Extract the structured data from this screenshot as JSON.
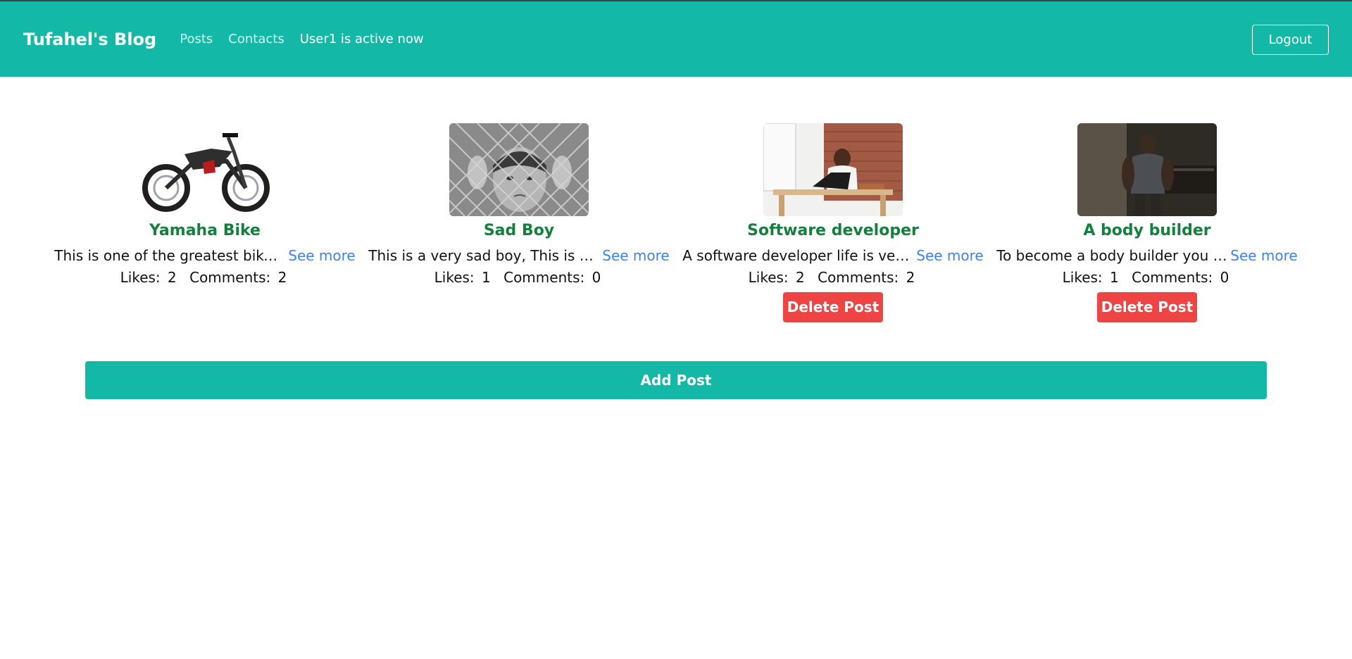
{
  "header": {
    "brand": "Tufahel's Blog",
    "nav": [
      {
        "label": "Posts"
      },
      {
        "label": "Contacts"
      }
    ],
    "status": "User1 is active now",
    "logout_label": "Logout"
  },
  "posts": [
    {
      "image_icon": "motorbike-image",
      "title": "Yamaha Bike",
      "excerpt": "This is one of the greatest bike…",
      "see_more": "See more",
      "likes_label": "Likes:",
      "likes": "2",
      "comments_label": "Comments:",
      "comments": "2",
      "delete_label": null
    },
    {
      "image_icon": "sad-boy-image",
      "title": "Sad Boy",
      "excerpt": "This is a very sad boy, This is a …",
      "see_more": "See more",
      "likes_label": "Likes:",
      "likes": "1",
      "comments_label": "Comments:",
      "comments": "0",
      "delete_label": null
    },
    {
      "image_icon": "developer-desk-image",
      "title": "Software developer",
      "excerpt": "A software developer life is ve…",
      "see_more": "See more",
      "likes_label": "Likes:",
      "likes": "2",
      "comments_label": "Comments:",
      "comments": "2",
      "delete_label": "Delete Post"
    },
    {
      "image_icon": "body-builder-image",
      "title": "A body builder",
      "excerpt": "To become a body builder you …",
      "see_more": "See more",
      "likes_label": "Likes:",
      "likes": "1",
      "comments_label": "Comments:",
      "comments": "0",
      "delete_label": "Delete Post"
    }
  ],
  "add_post_label": "Add Post",
  "colors": {
    "primary": "#14b8a6",
    "title_green": "#15803d",
    "link_blue": "#3b82f6",
    "danger": "#ef4444"
  }
}
